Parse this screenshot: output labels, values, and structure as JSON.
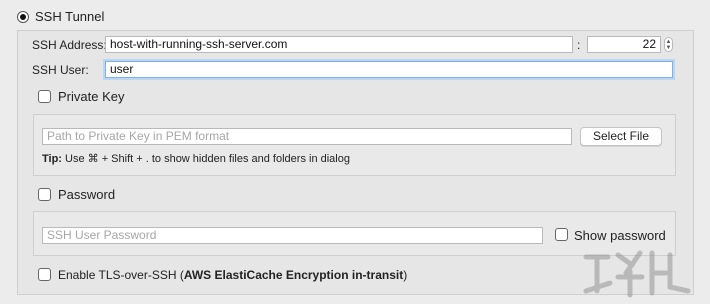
{
  "ssh_tunnel": {
    "label": "SSH Tunnel",
    "selected": true,
    "address_label": "SSH Address:",
    "address_value": "host-with-running-ssh-server.com",
    "port_separator": ":",
    "port_value": "22",
    "user_label": "SSH User:",
    "user_value": "user"
  },
  "private_key": {
    "checkbox_label": "Private Key",
    "checked": false,
    "path_placeholder": "Path to Private Key in PEM format",
    "select_file_label": "Select File",
    "tip_prefix": "Tip:",
    "tip_text": "Use ⌘ + Shift + . to show hidden files and folders in dialog"
  },
  "password": {
    "checkbox_label": "Password",
    "checked": false,
    "placeholder": "SSH User Password",
    "show_password_label": "Show password",
    "show_password_checked": false
  },
  "tls": {
    "label_prefix": "Enable TLS-over-SSH (",
    "label_bold": "AWS ElastiCache Encryption in-transit",
    "label_suffix": ")",
    "checked": false
  },
  "icons": {
    "radio": "radio-selected-icon",
    "stepper": "stepper-icon",
    "watermark": "watermark-logo"
  }
}
